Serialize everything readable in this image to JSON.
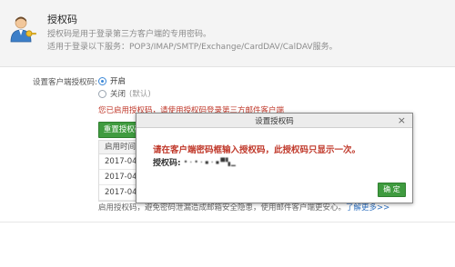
{
  "panel": {
    "title": "授权码",
    "description": "授权码是用于登录第三方客户端的专用密码。",
    "services": "适用于登录以下服务：POP3/IMAP/SMTP/Exchange/CardDAV/CalDAV服务。"
  },
  "settings": {
    "label": "设置客户端授权码:",
    "option_on": "开启",
    "option_off": "关闭",
    "option_off_default": "(默认)",
    "notice": "您已启用授权码，请使用授权码登录第三方邮件客户端",
    "regen_button": "重置授权码"
  },
  "history": {
    "header": "启用时间",
    "rows": [
      "2017-04-",
      "2017-04-",
      "2017-04-"
    ]
  },
  "footer": {
    "text": "启用授权码，避免密码泄漏造成邮箱安全隐患，使用邮件客户端更安心。",
    "link": "了解更多>>"
  },
  "modal": {
    "title": "设置授权码",
    "message": "请在客户端密码框输入授权码，此授权码只显示一次。",
    "code_label": "授权码:",
    "code_value": "•·•·▪·▪▀▚▁",
    "ok_button": "确 定",
    "close": "×"
  },
  "colors": {
    "accent_green": "#3f9b3f",
    "warning_red": "#c0392b",
    "link_blue": "#2c6fbf"
  }
}
